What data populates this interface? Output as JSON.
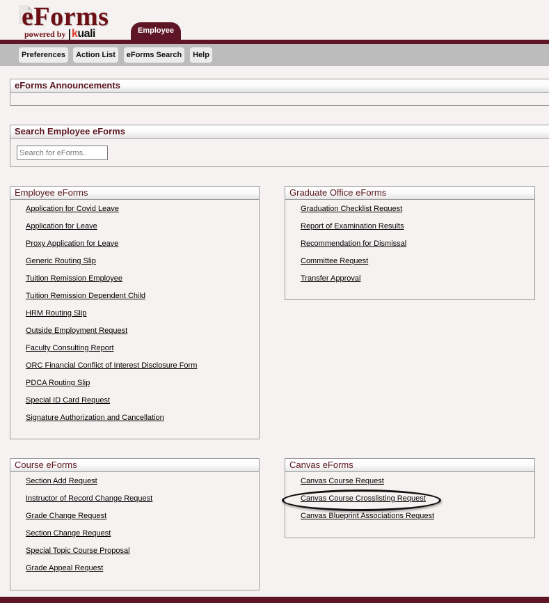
{
  "logo": {
    "title": "eForms",
    "powered_by": "powered by",
    "kuali_k": "k",
    "kuali_rest": "uali"
  },
  "header": {
    "active_tab": "Employee"
  },
  "toolbar": {
    "buttons": [
      {
        "label": "Preferences"
      },
      {
        "label": "Action List"
      },
      {
        "label": "eForms Search"
      },
      {
        "label": "Help"
      }
    ]
  },
  "announcements": {
    "title": "eForms Announcements"
  },
  "search": {
    "title": "Search Employee eForms",
    "placeholder": "Search for eForms..",
    "value": ""
  },
  "employee_eforms": {
    "title": "Employee eForms",
    "links": [
      "Application for Covid Leave",
      "Application for Leave",
      "Proxy Application for Leave",
      "Generic Routing Slip",
      "Tuition Remission Employee",
      "Tuition Remission Dependent Child",
      "HRM Routing Slip",
      "Outside Employment Request",
      "Faculty Consulting Report",
      "ORC Financial Conflict of Interest Disclosure Form",
      "PDCA Routing Slip",
      "Special ID Card Request",
      "Signature Authorization and Cancellation"
    ]
  },
  "graduate_eforms": {
    "title": "Graduate Office eForms",
    "links": [
      "Graduation Checklist Request",
      "Report of Examination Results",
      "Recommendation for Dismissal",
      "Committee Request",
      "Transfer Approval"
    ]
  },
  "course_eforms": {
    "title": "Course eForms",
    "links": [
      "Section Add Request",
      "Instructor of Record Change Request",
      "Grade Change Request",
      "Section Change Request",
      "Special Topic Course Proposal",
      "Grade Appeal Request"
    ]
  },
  "canvas_eforms": {
    "title": "Canvas eForms",
    "links": [
      "Canvas Course Request",
      "Canvas Course Crosslisting Request",
      "Canvas Blueprint Associations Request"
    ],
    "highlighted_link": "Canvas Course Crosslisting Request"
  },
  "colors": {
    "brand_maroon": "#5e1626",
    "logo_maroon": "#6e0f14",
    "page_background": "#f6f2f1",
    "toolbar_gray": "#bcbcbc"
  }
}
